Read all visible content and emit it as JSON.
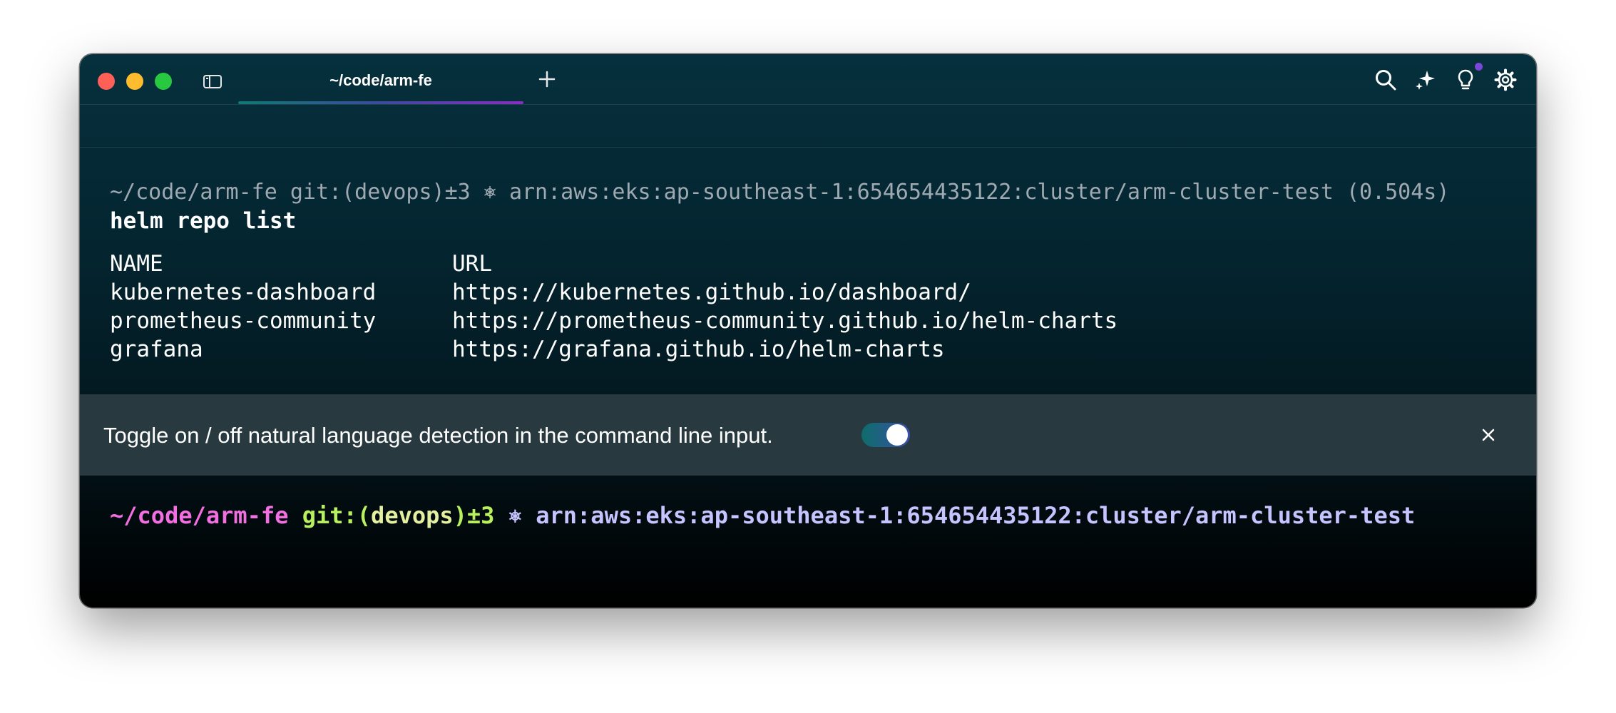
{
  "window": {
    "tab_title": "~/code/arm-fe",
    "new_tab_label": "+",
    "colors": {
      "close": "#fe5f57",
      "minimize": "#febc2e",
      "maximize": "#28c840",
      "accent_purple": "#8a2bc4",
      "accent_teal": "#0e7a73"
    },
    "icons": [
      "panel-toggle-icon",
      "plus-icon",
      "search-icon",
      "ai-sparkle-icon",
      "lightbulb-icon",
      "gear-icon"
    ]
  },
  "history_block": {
    "prompt_path": "~/code/arm-fe",
    "prompt_git": "git:(devops)±3",
    "prompt_helm_glyph": "⎈",
    "prompt_cluster": "arn:aws:eks:ap-southeast-1:654654435122:cluster/arm-cluster-test",
    "duration": "(0.504s)",
    "command": "helm repo list",
    "output": {
      "headers": [
        "NAME",
        "URL"
      ],
      "rows": [
        [
          "kubernetes-dashboard",
          "https://kubernetes.github.io/dashboard/"
        ],
        [
          "prometheus-community",
          "https://prometheus-community.github.io/helm-charts"
        ],
        [
          "grafana",
          "https://grafana.github.io/helm-charts"
        ]
      ]
    }
  },
  "tip_banner": {
    "text": "Toggle on / off natural language detection in the command line input.",
    "toggle_state": "on",
    "close_label": "×"
  },
  "active_prompt": {
    "path": "~/code/arm-fe",
    "git_label": "git:(",
    "branch": "devops",
    "git_suffix": ")±3",
    "helm_glyph": "⎈",
    "cluster": "arn:aws:eks:ap-southeast-1:654654435122:cluster/arm-cluster-test"
  }
}
